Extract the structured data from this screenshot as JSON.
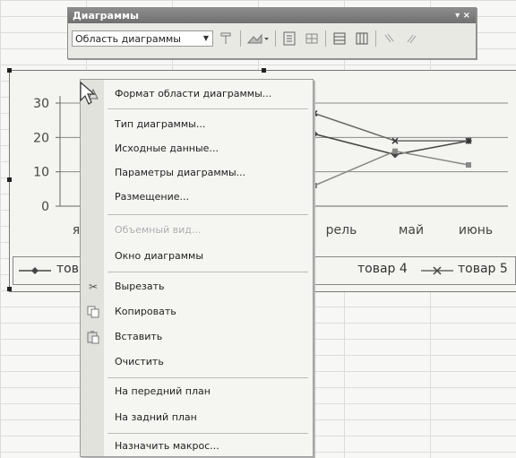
{
  "toolbar": {
    "title": "Диаграммы",
    "dropdown_arrow": "▾",
    "close_label": "▾ ×",
    "selected_element": "Область диаграммы",
    "select_arrow": "▼"
  },
  "chart_data": {
    "type": "line",
    "y_ticks": [
      "30",
      "20",
      "10",
      "0"
    ],
    "ylim": [
      0,
      30
    ],
    "x_tick_labels": [
      {
        "text": "я"
      },
      {
        "text": "рель"
      },
      {
        "text": "май"
      },
      {
        "text": "июнь"
      }
    ],
    "series": [
      {
        "name": "тов",
        "color": "#444444",
        "marker": "diamond",
        "values": [
          21,
          15,
          19
        ]
      },
      {
        "name": "товар 4",
        "color": "#888888",
        "marker": "square",
        "values": [
          6,
          16,
          12
        ]
      },
      {
        "name": "товар 5",
        "color": "#666666",
        "marker": "x",
        "values": [
          27,
          19,
          19
        ]
      }
    ],
    "legend": {
      "items": [
        "тов",
        "товар 4",
        "товар 5"
      ]
    }
  },
  "context_menu": {
    "items": [
      {
        "label": "Формат области диаграммы...",
        "icon": "format-icon",
        "disabled": false
      },
      {
        "label": "Тип диаграммы...",
        "disabled": false
      },
      {
        "label": "Исходные данные...",
        "disabled": false
      },
      {
        "label": "Параметры диаграммы...",
        "disabled": false
      },
      {
        "label": "Размещение...",
        "disabled": false
      },
      {
        "label": "Объемный вид...",
        "disabled": true
      },
      {
        "label": "Окно диаграммы",
        "disabled": false
      },
      {
        "label": "Вырезать",
        "icon": "scissors-icon",
        "disabled": false
      },
      {
        "label": "Копировать",
        "icon": "copy-icon",
        "disabled": false
      },
      {
        "label": "Вставить",
        "icon": "paste-icon",
        "disabled": false
      },
      {
        "label": "Очистить",
        "disabled": false
      },
      {
        "label": "На передний план",
        "disabled": false
      },
      {
        "label": "На задний план",
        "disabled": false
      },
      {
        "label": "Назначить макрос...",
        "disabled": false
      }
    ]
  }
}
